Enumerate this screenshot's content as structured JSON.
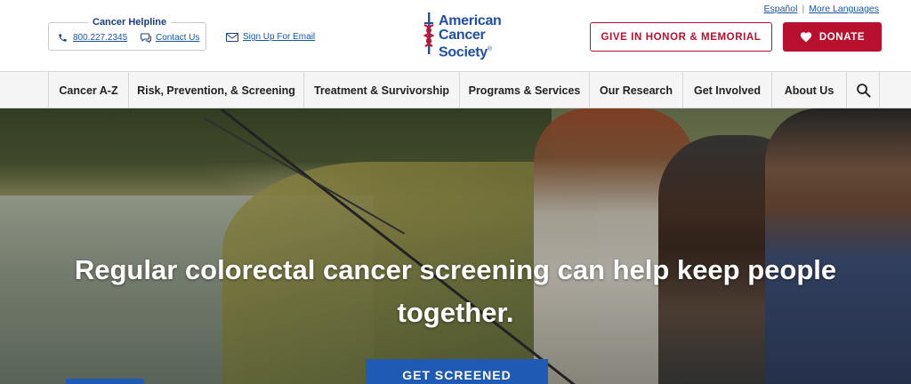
{
  "header": {
    "languages": {
      "espanol": "Español",
      "more": "More Languages",
      "separator": "|"
    },
    "helpline": {
      "title": "Cancer Helpline",
      "phone": "800.227.2345",
      "contact": "Contact Us"
    },
    "signup": "Sign Up For Email",
    "logo": {
      "line1": "American",
      "line2": "Cancer",
      "line3": "Society",
      "mark": "®"
    },
    "honor_button": "GIVE IN HONOR & MEMORIAL",
    "donate_button": "DONATE"
  },
  "nav": {
    "items": [
      {
        "label": "Cancer A-Z"
      },
      {
        "label": "Risk, Prevention, & Screening"
      },
      {
        "label": "Treatment & Survivorship"
      },
      {
        "label": "Programs & Services"
      },
      {
        "label": "Our Research"
      },
      {
        "label": "Get Involved"
      },
      {
        "label": "About Us"
      }
    ],
    "search_icon": "search-icon"
  },
  "hero": {
    "headline": "Regular colorectal cancer screening can help keep people together.",
    "cta": "GET SCREENED"
  },
  "colors": {
    "brand_blue": "#1f4ea3",
    "link_blue": "#1a56a6",
    "brand_red": "#b8102e",
    "cta_blue": "#1f5bb5"
  }
}
